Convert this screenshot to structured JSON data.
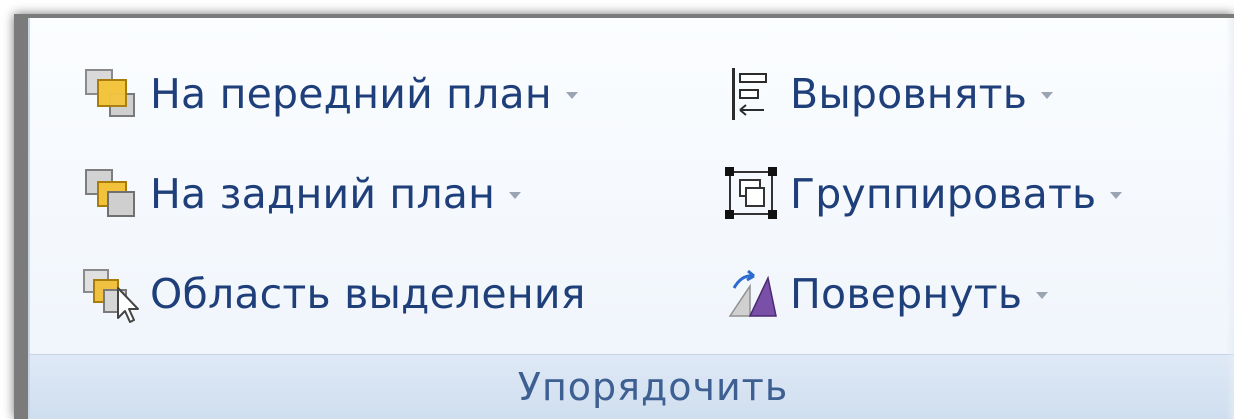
{
  "group": {
    "title": "Упорядочить"
  },
  "commands": [
    {
      "label": "На передний план",
      "icon": "bring-to-front-icon",
      "has_dropdown": true
    },
    {
      "label": "На задний план",
      "icon": "send-to-back-icon",
      "has_dropdown": true
    },
    {
      "label": "Область выделения",
      "icon": "selection-pane-icon",
      "has_dropdown": false
    },
    {
      "label": "Выровнять",
      "icon": "align-icon",
      "has_dropdown": true
    },
    {
      "label": "Группировать",
      "icon": "group-objects-icon",
      "has_dropdown": true
    },
    {
      "label": "Повернуть",
      "icon": "rotate-icon",
      "has_dropdown": true
    }
  ],
  "colors": {
    "text": "#1f3f7a",
    "group_title": "#3d5f92",
    "footer": "#d5e2f2"
  }
}
